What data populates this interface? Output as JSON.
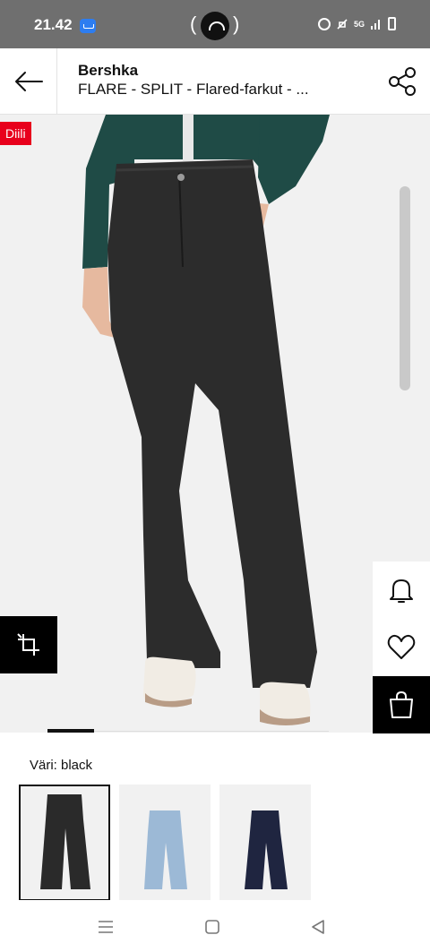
{
  "status_bar": {
    "time": "21.42",
    "network": "5G"
  },
  "header": {
    "brand": "Bershka",
    "product_title": "FLARE - SPLIT - Flared-farkut - ..."
  },
  "gallery": {
    "badge": "Diili",
    "current_image": 1
  },
  "colors": {
    "label": "Väri: black",
    "options": [
      {
        "name": "black",
        "wash": "#2a2a2a",
        "selected": true
      },
      {
        "name": "light blue",
        "wash": "#9cb9d6",
        "selected": false
      },
      {
        "name": "dark blue",
        "wash": "#1f2540",
        "selected": false
      }
    ]
  },
  "icons": {
    "back": "arrow-left-icon",
    "share": "share-icon",
    "crop": "crop-icon",
    "notify": "bell-icon",
    "wishlist": "heart-icon",
    "bag": "shopping-bag-icon"
  },
  "accent_colors": {
    "deal_badge": "#e8001c",
    "primary": "#000000"
  }
}
